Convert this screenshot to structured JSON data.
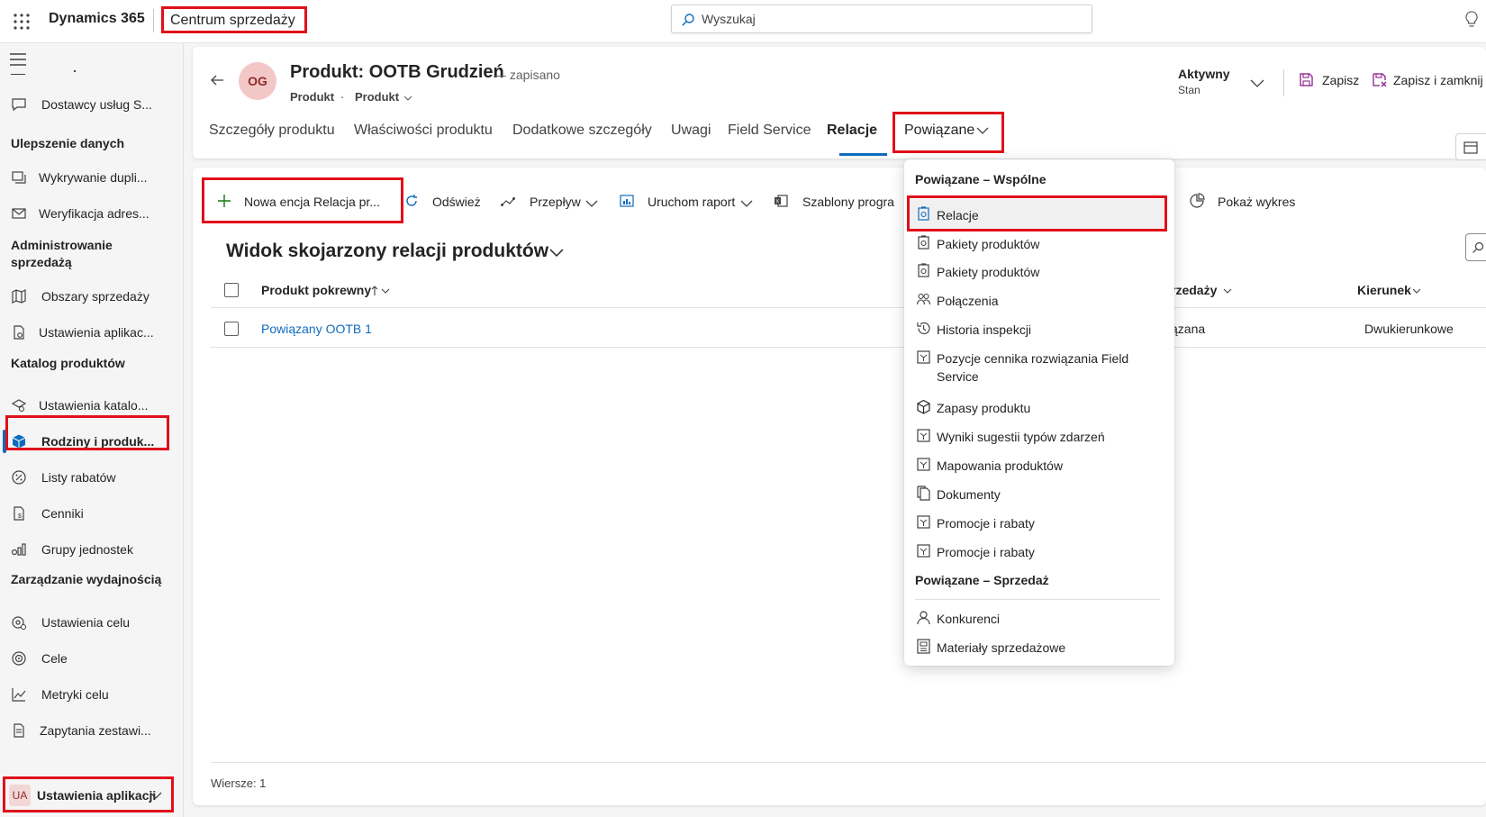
{
  "topbar": {
    "brand": "Dynamics 365",
    "app_name": "Centrum sprzedaży",
    "search_placeholder": "Wyszukaj"
  },
  "sidebar": {
    "items": [
      {
        "label": "Dostawcy usług S...",
        "icon": "chat-icon"
      },
      {
        "group": "Ulepszenie danych"
      },
      {
        "label": "Wykrywanie dupli...",
        "icon": "duplicate-icon"
      },
      {
        "label": "Weryfikacja adres...",
        "icon": "mail-icon"
      },
      {
        "group": "Administrowanie sprzedażą"
      },
      {
        "label": "Obszary sprzedaży",
        "icon": "map-icon"
      },
      {
        "label": "Ustawienia aplikac...",
        "icon": "settings-doc-icon"
      },
      {
        "group": "Katalog produktów"
      },
      {
        "label": "Ustawienia katalo...",
        "icon": "catalog-settings-icon"
      },
      {
        "label": "Rodziny i produk...",
        "icon": "box-icon",
        "active": true
      },
      {
        "label": "Listy rabatów",
        "icon": "percent-icon"
      },
      {
        "label": "Cenniki",
        "icon": "price-list-icon"
      },
      {
        "label": "Grupy jednostek",
        "icon": "units-icon"
      },
      {
        "group": "Zarządzanie wydajnością"
      },
      {
        "label": "Ustawienia celu",
        "icon": "goal-settings-icon"
      },
      {
        "label": "Cele",
        "icon": "target-icon"
      },
      {
        "label": "Metryki celu",
        "icon": "metric-icon"
      },
      {
        "label": "Zapytania zestawi...",
        "icon": "query-icon"
      }
    ],
    "area_badge": "UA",
    "area_label": "Ustawienia aplikacji"
  },
  "record": {
    "avatar": "OG",
    "title": "Produkt: OOTB Grudzień",
    "saved": "— zapisano",
    "entity": "Produkt",
    "separator": "·",
    "form": "Produkt",
    "status_value": "Aktywny",
    "status_label": "Stan",
    "save_label": "Zapisz",
    "save_close_label": "Zapisz i zamknij"
  },
  "tabs": [
    "Szczegóły produktu",
    "Właściwości produktu",
    "Dodatkowe szczegóły",
    "Uwagi",
    "Field Service",
    "Relacje",
    "Powiązane"
  ],
  "commands": {
    "new": "Nowa encja Relacja pr...",
    "refresh": "Odśwież",
    "flow": "Przepływ",
    "report": "Uruchom raport",
    "templates": "Szablony progra",
    "chart": "Pokaż wykres"
  },
  "view": {
    "title": "Widok skojarzony relacji produktów",
    "columns": [
      "Produkt pokrewny",
      "rzedaży",
      "Kierunek"
    ],
    "rows": [
      {
        "product": "Powiązany OOTB 1",
        "type": "ązana",
        "direction": "Dwukierunkowe"
      }
    ],
    "footer": "Wiersze: 1"
  },
  "dropdown": {
    "group_common": "Powiązane – Wspólne",
    "items_common": [
      {
        "label": "Relacje",
        "icon": "relationship-icon",
        "selected": true
      },
      {
        "label": "Pakiety produktów",
        "icon": "bundle-icon"
      },
      {
        "label": "Pakiety produktów",
        "icon": "bundle-icon"
      },
      {
        "label": "Połączenia",
        "icon": "connections-icon"
      },
      {
        "label": "Historia inspekcji",
        "icon": "history-icon"
      },
      {
        "label": "Pozycje cennika rozwiązania Field Service",
        "icon": "entity-icon"
      },
      {
        "label": "Zapasy produktu",
        "icon": "cube-icon"
      },
      {
        "label": "Wyniki sugestii typów zdarzeń",
        "icon": "entity-icon"
      },
      {
        "label": "Mapowania produktów",
        "icon": "entity-icon"
      },
      {
        "label": "Dokumenty",
        "icon": "document-icon"
      },
      {
        "label": "Promocje i rabaty",
        "icon": "entity-icon"
      },
      {
        "label": "Promocje i rabaty",
        "icon": "entity-icon"
      }
    ],
    "group_sales": "Powiązane – Sprzedaż",
    "items_sales": [
      {
        "label": "Konkurenci",
        "icon": "competitor-icon"
      },
      {
        "label": "Materiały sprzedażowe",
        "icon": "sales-literature-icon"
      }
    ]
  },
  "colors": {
    "accent": "#0f6cbd",
    "highlight_box": "#e0101a",
    "avatar_bg": "#f4c7c7",
    "save_icon": "#8b1e8b"
  }
}
